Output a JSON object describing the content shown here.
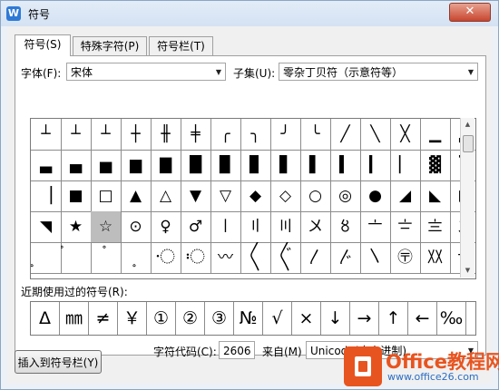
{
  "window": {
    "title": "符号",
    "close_symbol": "✕"
  },
  "tabs": [
    {
      "label": "符号(S)",
      "active": true
    },
    {
      "label": "特殊字符(P)",
      "active": false
    },
    {
      "label": "符号栏(T)",
      "active": false
    }
  ],
  "font": {
    "label": "字体(F):",
    "value": "宋体"
  },
  "subset": {
    "label": "子集(U):",
    "value": "零杂丁贝符（示意符等）"
  },
  "symbol_rows": [
    [
      "┴",
      "┴",
      "┴",
      "┼",
      "╫",
      "╪",
      "╭",
      "╮",
      "╯",
      "╰",
      "╱",
      "╲",
      "╳",
      "▁",
      "▂"
    ],
    [
      "▃",
      "▄",
      "▅",
      "▆",
      "▇",
      "█",
      "▉",
      "▊",
      "▋",
      "▌",
      "▍",
      "▎",
      "▏",
      "▓",
      "▔"
    ],
    [
      "▕",
      "■",
      "□",
      "▲",
      "△",
      "▼",
      "▽",
      "◆",
      "◇",
      "○",
      "◎",
      "●",
      "◢",
      "◣",
      "◤"
    ],
    [
      "◥",
      "★",
      "☆",
      "⊙",
      "♀",
      "♂",
      "〡",
      "〢",
      "〣",
      "〤",
      "〥",
      "〦",
      "〧",
      "〨",
      "〩"
    ],
    [
      "〪",
      "〫",
      "〬",
      "〭",
      "〮",
      "〯",
      "〰",
      "〱",
      "〲",
      "〳",
      "〴",
      "〵",
      "〶",
      "〷",
      "〸"
    ]
  ],
  "selected": {
    "row": 3,
    "col": 2
  },
  "recent": {
    "label": "近期使用过的符号(R):",
    "symbols": [
      "Δ",
      "㎜",
      "≠",
      "￥",
      "①",
      "②",
      "③",
      "№",
      "√",
      "×",
      "↓",
      "→",
      "↑",
      "←",
      "‰"
    ]
  },
  "char_code": {
    "label": "字符代码(C):",
    "value": "2606"
  },
  "from": {
    "label": "来自(M)",
    "value": "Unicode(十六进制)"
  },
  "buttons": {
    "insert_to_bar": "插入到符号栏(Y)"
  },
  "watermark": {
    "brand": "Office教程网",
    "url": "www.office26.com"
  }
}
